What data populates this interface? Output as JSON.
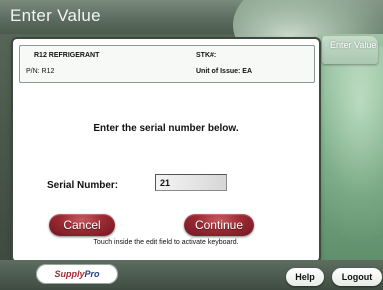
{
  "window": {
    "title": "Enter Value"
  },
  "side_tab": {
    "label": "Enter Value"
  },
  "item": {
    "name": "R12 REFRIGERANT",
    "stk_label": "STK#:",
    "pn": "P/N: R12",
    "unit_of_issue": "Unit of Issue: EA"
  },
  "prompt": "Enter the serial number below.",
  "serial": {
    "label": "Serial Number:",
    "value": "21"
  },
  "buttons": {
    "cancel": "Cancel",
    "continue": "Continue",
    "help": "Help",
    "logout": "Logout"
  },
  "hint": "Touch inside the edit field to activate keyboard.",
  "logo": {
    "supply": "Supply",
    "pro": "Pro"
  },
  "colors": {
    "pill_red": "#9b2a33",
    "panel_green": "#7fb08b",
    "logo_blue": "#1c3d8a"
  }
}
